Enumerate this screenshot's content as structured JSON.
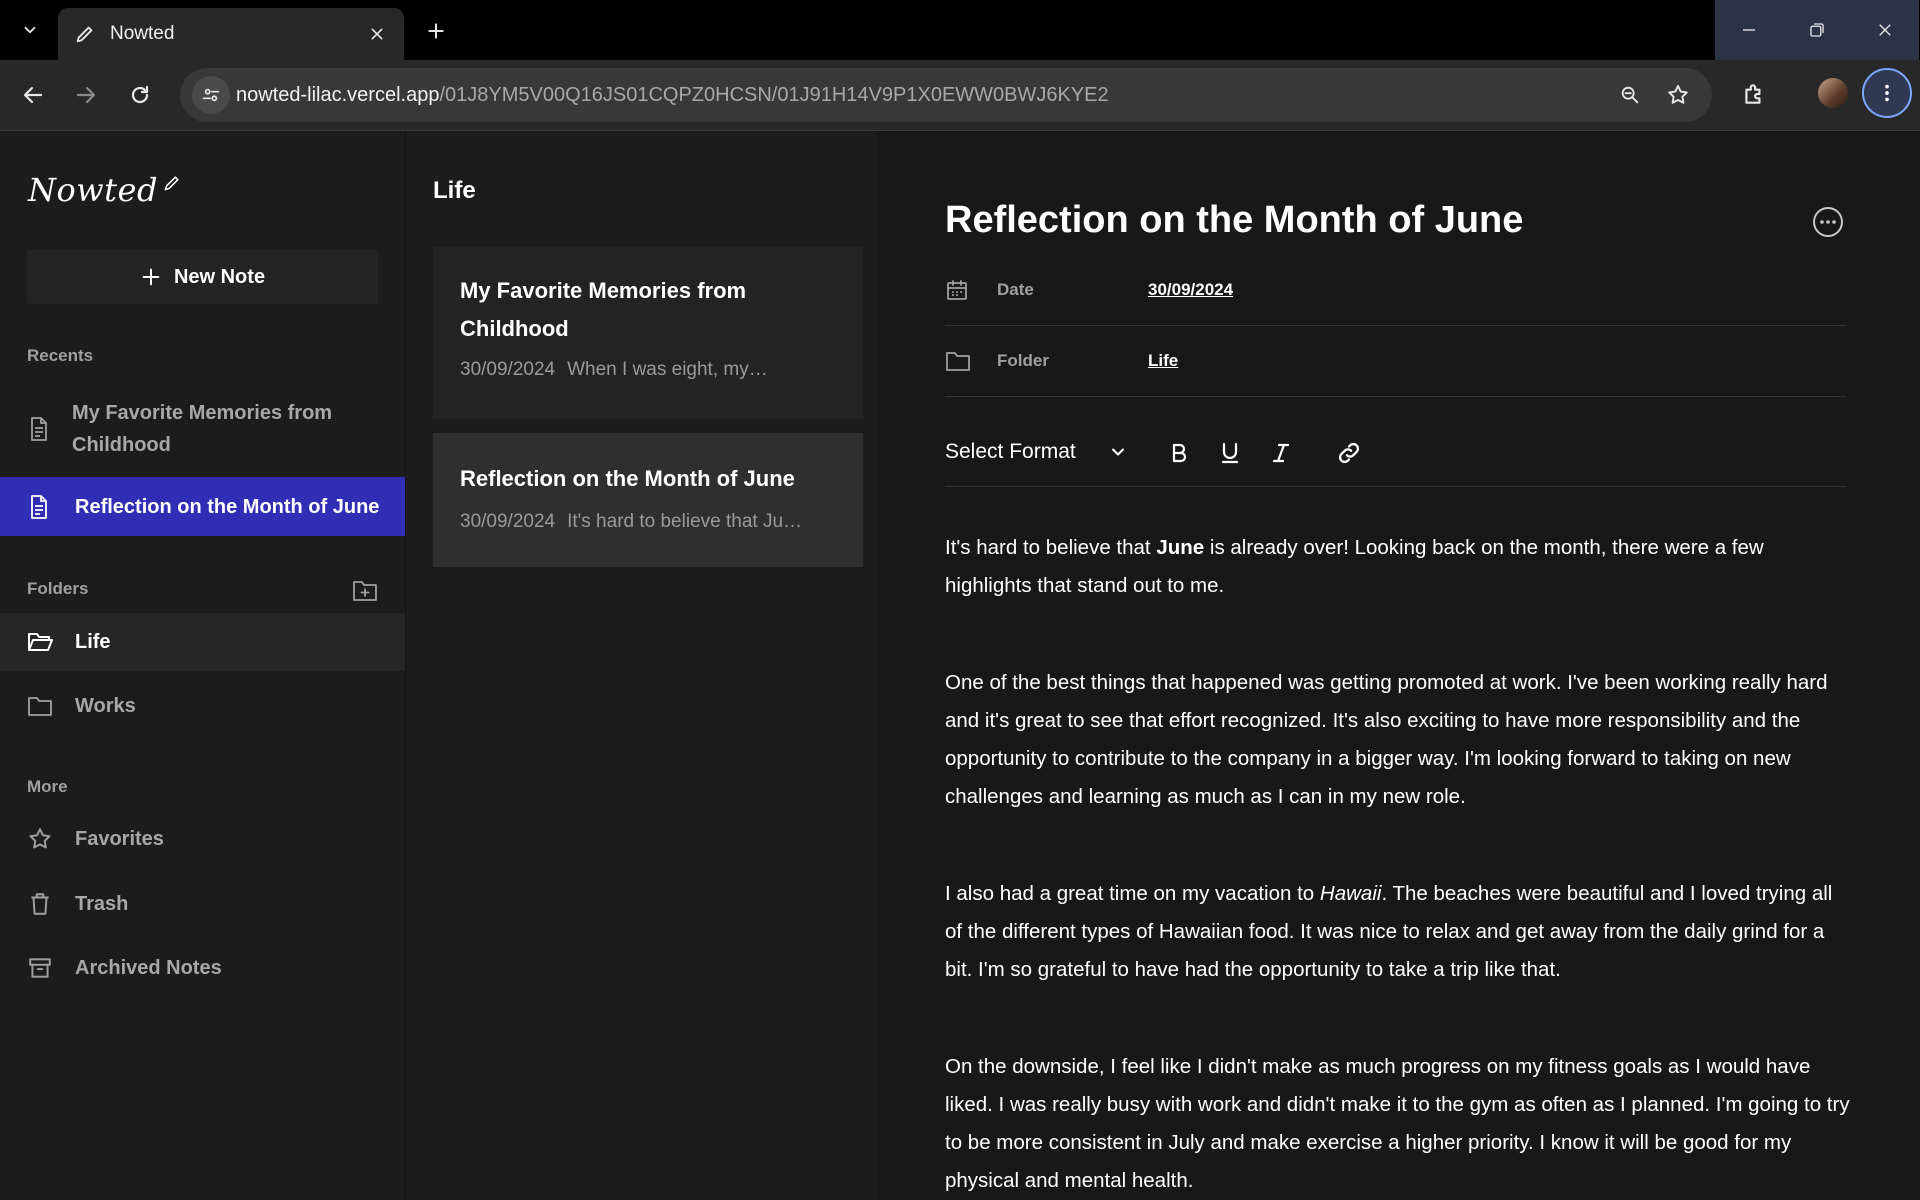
{
  "browser": {
    "tab_title": "Nowted",
    "url_host": "nowted-lilac.vercel.app",
    "url_path": "/01J8YM5V00Q16JS01CQPZ0HCSN/01J91H14V9P1X0EWW0BWJ6KYE2"
  },
  "sidebar": {
    "logo": "Nowted",
    "new_note_label": "New Note",
    "recents_heading": "Recents",
    "recents": [
      {
        "label": "My Favorite Memories from Childhood",
        "icon": "document-icon"
      },
      {
        "label": "Reflection on the Month of June",
        "icon": "document-icon",
        "active": true
      }
    ],
    "folders_heading": "Folders",
    "folders": [
      {
        "label": "Life",
        "icon": "folder-open-icon",
        "active": true
      },
      {
        "label": "Works",
        "icon": "folder-icon"
      }
    ],
    "more_heading": "More",
    "more": [
      {
        "label": "Favorites",
        "icon": "star-icon"
      },
      {
        "label": "Trash",
        "icon": "trash-icon"
      },
      {
        "label": "Archived Notes",
        "icon": "archive-icon"
      }
    ]
  },
  "note_list": {
    "title": "Life",
    "notes": [
      {
        "title": "My Favorite Memories from Childhood",
        "date": "30/09/2024",
        "preview": "When I was eight, my…"
      },
      {
        "title": "Reflection on the Month of June",
        "date": "30/09/2024",
        "preview": "It's hard to believe that Ju…",
        "selected": true
      }
    ]
  },
  "editor": {
    "title": "Reflection on the Month of June",
    "date_label": "Date",
    "date_value": "30/09/2024",
    "folder_label": "Folder",
    "folder_value": "Life",
    "format_select": "Select Format",
    "paragraphs": [
      [
        "It's hard to believe that ",
        "June",
        " is already over! Looking back on the month, there were a few highlights that stand out to me."
      ],
      [
        "One of the best things that happened was getting promoted at work. I've been working really hard and it's great to see that effort recognized. It's also exciting to have more responsibility and the opportunity to contribute to the company in a bigger way. I'm looking forward to taking on new challenges and learning as much as I can in my new role."
      ],
      [
        "I also had a great time on my vacation to ",
        "Hawaii",
        ". The beaches were beautiful and I loved trying all of the different types of Hawaiian food. It was nice to relax and get away from the daily grind for a bit. I'm so grateful to have had the opportunity to take a trip like that."
      ],
      [
        "On the downside, I feel like I didn't make as much progress on my fitness goals as I would have liked. I was really busy with work and didn't make it to the gym as often as I planned. I'm going to try to be more consistent in July and make exercise a higher priority. I know it will be good for my physical and mental health."
      ]
    ]
  },
  "colors": {
    "accent": "#312eb5",
    "background": "#181818",
    "sidebar_bg": "#1c1c1c",
    "card_bg": "#232323",
    "card_selected_bg": "#2f2f2f"
  }
}
